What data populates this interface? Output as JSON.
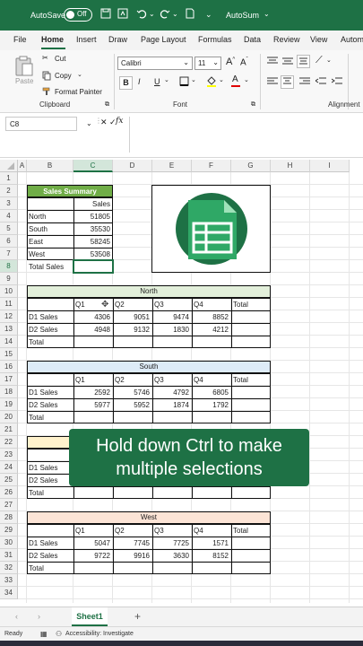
{
  "titlebar": {
    "autosave_label": "AutoSave",
    "toggle_label": "Off",
    "app_title": "AutoSum",
    "accent": "#1e7145"
  },
  "tabs": [
    "File",
    "Home",
    "Insert",
    "Draw",
    "Page Layout",
    "Formulas",
    "Data",
    "Review",
    "View",
    "Autom"
  ],
  "ribbon": {
    "paste_label": "Paste",
    "cut_label": "Cut",
    "copy_label": "Copy",
    "format_painter_label": "Format Painter",
    "clipboard_label": "Clipboard",
    "font_name": "Calibri",
    "font_size": "11",
    "bold": "B",
    "italic": "I",
    "underline": "U",
    "font_label": "Font",
    "alignment_label": "Alignment"
  },
  "formula_bar": {
    "name_box": "C8",
    "fx": "fx"
  },
  "columns": [
    "A",
    "B",
    "C",
    "D",
    "E",
    "F",
    "G",
    "H",
    "I"
  ],
  "rows": [
    "1",
    "2",
    "3",
    "4",
    "5",
    "6",
    "7",
    "8",
    "9",
    "10",
    "11",
    "12",
    "13",
    "14",
    "15",
    "16",
    "17",
    "18",
    "19",
    "20",
    "21",
    "22",
    "23",
    "24",
    "25",
    "26",
    "27",
    "28",
    "29",
    "30",
    "31",
    "32",
    "33",
    "34"
  ],
  "summary": {
    "title": "Sales Summary",
    "header": "Sales",
    "rows": [
      {
        "label": "North",
        "value": "51805"
      },
      {
        "label": "South",
        "value": "35530"
      },
      {
        "label": "East",
        "value": "58245"
      },
      {
        "label": "West",
        "value": "53508"
      }
    ],
    "total_label": "Total Sales"
  },
  "quarters": [
    "Q1",
    "Q2",
    "Q3",
    "Q4"
  ],
  "total_col": "Total",
  "regions": {
    "north": {
      "title": "North",
      "rows": [
        {
          "label": "D1 Sales",
          "values": [
            "4306",
            "9051",
            "9474",
            "8852"
          ]
        },
        {
          "label": "D2 Sales",
          "values": [
            "4948",
            "9132",
            "1830",
            "4212"
          ]
        }
      ],
      "total_label": "Total"
    },
    "south": {
      "title": "South",
      "rows": [
        {
          "label": "D1 Sales",
          "values": [
            "2592",
            "5746",
            "4792",
            "6805"
          ]
        },
        {
          "label": "D2 Sales",
          "values": [
            "5977",
            "5952",
            "1874",
            "1792"
          ]
        }
      ],
      "total_label": "Total"
    },
    "east": {
      "rows": [
        {
          "label": "D1 Sales"
        },
        {
          "label": "D2 Sales"
        }
      ],
      "total_label": "Total"
    },
    "west": {
      "title": "West",
      "rows": [
        {
          "label": "D1 Sales",
          "values": [
            "5047",
            "7745",
            "7725",
            "1571"
          ]
        },
        {
          "label": "D2 Sales",
          "values": [
            "9722",
            "9916",
            "3630",
            "8152"
          ]
        }
      ],
      "total_label": "Total"
    }
  },
  "overlay_text": [
    "Hold down Ctrl to make",
    "multiple selections"
  ],
  "sheet_tab": "Sheet1",
  "status": {
    "ready": "Ready",
    "accessibility": "Accessibility: Investigate"
  },
  "colors": {
    "north_header": "#e2efda",
    "south_header": "#ddebf7",
    "east_header": "#fff2cc",
    "west_header": "#fce4d6",
    "summary_header": "#70ad47"
  }
}
